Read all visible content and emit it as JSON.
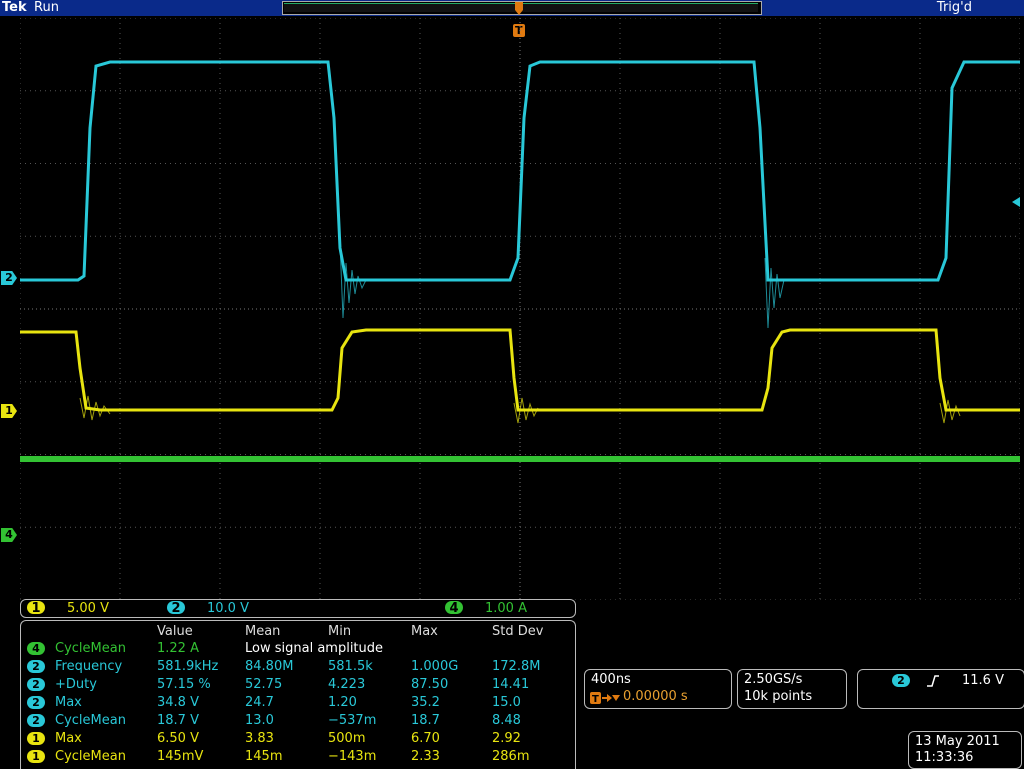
{
  "header": {
    "brand": "Tek",
    "run_state": "Run",
    "trigger_status": "Trig'd",
    "trigger_marker": "T"
  },
  "channels": [
    {
      "id": "1",
      "color": "#e8e410"
    },
    {
      "id": "2",
      "color": "#29c8d8"
    },
    {
      "id": "4",
      "color": "#33c233"
    }
  ],
  "scales": {
    "ch1": "5.00 V",
    "ch2": "10.0 V",
    "ch4": "1.00 A"
  },
  "measurements": {
    "headers": [
      "Value",
      "Mean",
      "Min",
      "Max",
      "Std Dev"
    ],
    "rows": [
      {
        "ch": "4",
        "name": "CycleMean",
        "value": "1.22 A",
        "note": "Low signal amplitude"
      },
      {
        "ch": "2",
        "name": "Frequency",
        "value": "581.9kHz",
        "mean": "84.80M",
        "min": "581.5k",
        "max": "1.000G",
        "std": "172.8M"
      },
      {
        "ch": "2",
        "name": "+Duty",
        "value": "57.15 %",
        "mean": "52.75",
        "min": "4.223",
        "max": "87.50",
        "std": "14.41"
      },
      {
        "ch": "2",
        "name": "Max",
        "value": "34.8 V",
        "mean": "24.7",
        "min": "1.20",
        "max": "35.2",
        "std": "15.0"
      },
      {
        "ch": "2",
        "name": "CycleMean",
        "value": "18.7 V",
        "mean": "13.0",
        "min": "−537m",
        "max": "18.7",
        "std": "8.48"
      },
      {
        "ch": "1",
        "name": "Max",
        "value": "6.50 V",
        "mean": "3.83",
        "min": "500m",
        "max": "6.70",
        "std": "2.92"
      },
      {
        "ch": "1",
        "name": "CycleMean",
        "value": "145mV",
        "mean": "145m",
        "min": "−143m",
        "max": "2.33",
        "std": "286m"
      }
    ]
  },
  "timebase": {
    "scale": "400ns",
    "position": "0.00000 s"
  },
  "acquisition": {
    "rate": "2.50GS/s",
    "points": "10k points"
  },
  "trigger": {
    "source": "2",
    "slope_icon": "rising-edge-icon",
    "level": "11.6 V"
  },
  "datetime": {
    "date": "13 May 2011",
    "time": "11:33:36"
  }
}
